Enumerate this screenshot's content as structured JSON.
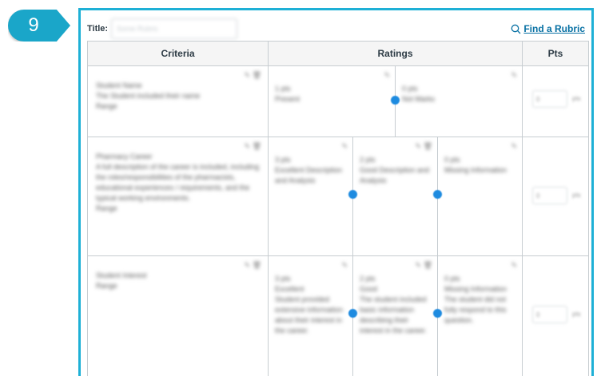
{
  "step": {
    "number": "9"
  },
  "header": {
    "title_label": "Title:",
    "title_value": "Some Rubric",
    "find_link": "Find a Rubric"
  },
  "table": {
    "col_criteria": "Criteria",
    "col_ratings": "Ratings",
    "col_pts": "Pts",
    "rows": [
      {
        "name": "Student Name",
        "desc": "The Student included their name",
        "range": "Range",
        "ratings": [
          {
            "pts": "1 pts",
            "title": "Present",
            "desc": ""
          },
          {
            "pts": "0 pts",
            "title": "Not Marks",
            "desc": ""
          }
        ],
        "pts_value": "0",
        "pts_unit": "pts"
      },
      {
        "name": "Pharmacy Career",
        "desc": "A full description of the career is included, including the roles/responsibilities of the pharmacists, educational experiences / requirements, and the typical working environments.",
        "range": "Range",
        "ratings": [
          {
            "pts": "3 pts",
            "title": "Excellent Description and Analysis",
            "desc": ""
          },
          {
            "pts": "2 pts",
            "title": "Good Description and Analysis",
            "desc": ""
          },
          {
            "pts": "0 pts",
            "title": "Missing Information",
            "desc": ""
          }
        ],
        "pts_value": "0",
        "pts_unit": "pts"
      },
      {
        "name": "Student Interest",
        "desc": "",
        "range": "Range",
        "ratings": [
          {
            "pts": "3 pts",
            "title": "Excellent",
            "desc": "Student provided extensive information about their interest in the career."
          },
          {
            "pts": "2 pts",
            "title": "Good",
            "desc": "The student included basic information describing their interest in the career."
          },
          {
            "pts": "0 pts",
            "title": "Missing Information",
            "desc": "The student did not fully respond to this question."
          }
        ],
        "pts_value": "0",
        "pts_unit": "pts"
      }
    ]
  },
  "colors": {
    "accent": "#1eb0d6",
    "badge": "#1aa6c9",
    "link": "#0770a3",
    "dot": "#1e8be0"
  }
}
